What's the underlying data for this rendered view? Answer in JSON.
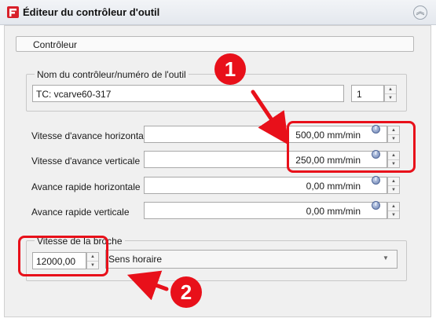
{
  "window": {
    "title": "Éditeur du contrôleur d'outil",
    "app_icon": "freecad-logo-icon",
    "collapse_icon": "chevron-double-up-icon"
  },
  "section": {
    "header": "Contrôleur"
  },
  "tool_group": {
    "title": "Nom du contrôleur/numéro de l'outil",
    "name_value": "TC: vcarve60-317",
    "tool_number": "1"
  },
  "feeds": [
    {
      "label": "Vitesse d'avance horizontale",
      "value": "500,00 mm/min"
    },
    {
      "label": "Vitesse d'avance verticale",
      "value": "250,00 mm/min"
    },
    {
      "label": "Avance rapide horizontale",
      "value": "0,00 mm/min"
    },
    {
      "label": "Avance rapide verticale",
      "value": "0,00 mm/min"
    }
  ],
  "spindle_group": {
    "title": "Vitesse de la broche",
    "speed_value": "12000,00",
    "direction_value": "Sens horaire"
  },
  "annotations": {
    "callout_1": "1",
    "callout_2": "2",
    "highlight_color": "#e8101a"
  },
  "spin_up_glyph": "▲",
  "spin_down_glyph": "▼",
  "dropdown_glyph": "▼",
  "collapse_glyph": "︽"
}
